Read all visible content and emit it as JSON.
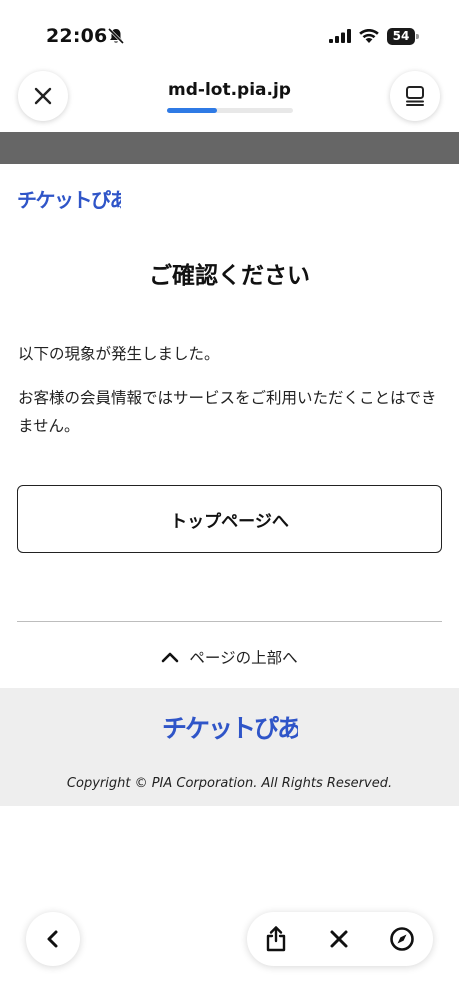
{
  "status_bar": {
    "time": "22:06",
    "battery_level": "54",
    "icons": [
      "bell-off-icon",
      "signal-icon",
      "wifi-icon",
      "battery-icon"
    ]
  },
  "browser": {
    "url": "md-lot.pia.jp",
    "load_progress": 0.4,
    "accent_color": "#2f7ae5",
    "icons": [
      "close-icon",
      "tabs-icon",
      "back-icon",
      "share-icon",
      "stop-icon",
      "compass-icon"
    ]
  },
  "page": {
    "logo_alt": "チケットぴあ",
    "logo_color": "#2f55c8",
    "title": "ご確認ください",
    "message_1": "以下の現象が発生しました。",
    "message_2": "お客様の会員情報ではサービスをご利用いただくことはできません。",
    "top_page_button_label": "トップページへ",
    "page_top_link_label": "ページの上部へ",
    "copyright": "Copyright © PIA Corporation. All Rights Reserved."
  }
}
